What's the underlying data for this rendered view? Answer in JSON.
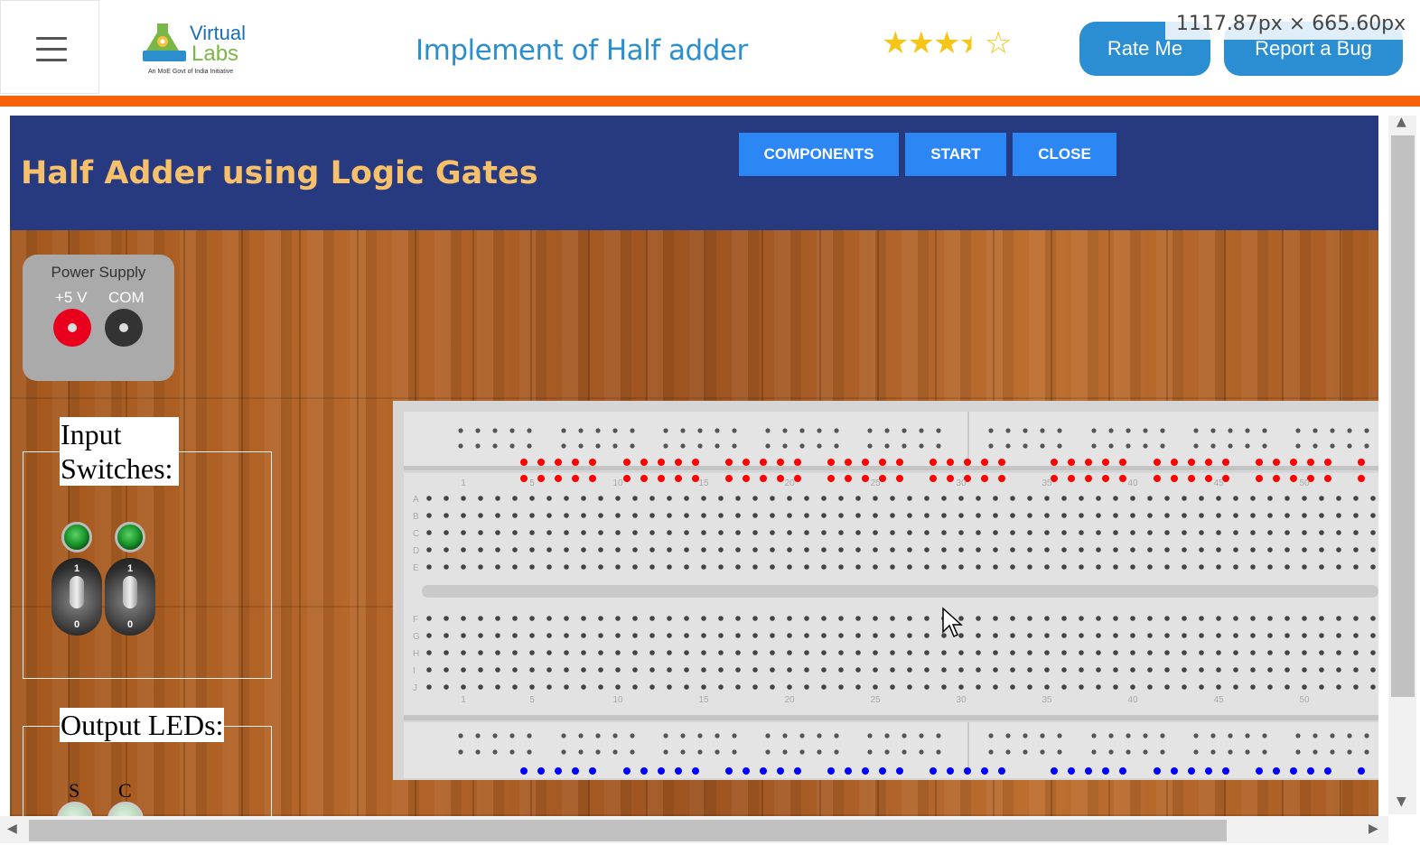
{
  "header": {
    "logo": {
      "line1": "Virtual",
      "line2": "Labs",
      "tagline": "An MoE Govt of India Initiative"
    },
    "title": "Implement of Half adder",
    "rating": {
      "value": 3.5,
      "max": 5
    },
    "rate_button": "Rate Me",
    "bug_button": "Report a Bug",
    "dimension_overlay": "1117.87px × 665.60px"
  },
  "simulator": {
    "title": "Half Adder using Logic Gates",
    "buttons": {
      "components": "COMPONENTS",
      "start": "START",
      "close": "CLOSE"
    },
    "power_supply": {
      "title": "Power Supply",
      "plus_label": "+5 V",
      "com_label": "COM"
    },
    "input_group": {
      "legend": "Input Switches:",
      "switches": [
        {
          "label_on": "1",
          "label_off": "0",
          "led": "on"
        },
        {
          "label_on": "1",
          "label_off": "0",
          "led": "on"
        }
      ]
    },
    "output_group": {
      "legend": "Output LEDs:",
      "leds": [
        {
          "label": "S"
        },
        {
          "label": "C"
        }
      ]
    },
    "breadboard": {
      "row_labels_top": [
        "A",
        "B",
        "C",
        "D",
        "E"
      ],
      "row_labels_bottom": [
        "F",
        "G",
        "H",
        "I",
        "J"
      ],
      "column_numbers": [
        "1",
        "5",
        "10",
        "15",
        "20",
        "25",
        "30",
        "35",
        "40",
        "45",
        "50"
      ],
      "power_rail_positive_color": "#ff0000",
      "power_rail_negative_color": "#0000ff"
    }
  },
  "colors": {
    "accent": "#2b8ed3",
    "orange_bar": "#f7630c",
    "sim_header": "#27397f",
    "sim_title": "#f7c06a",
    "sim_button": "#2c86f3"
  }
}
